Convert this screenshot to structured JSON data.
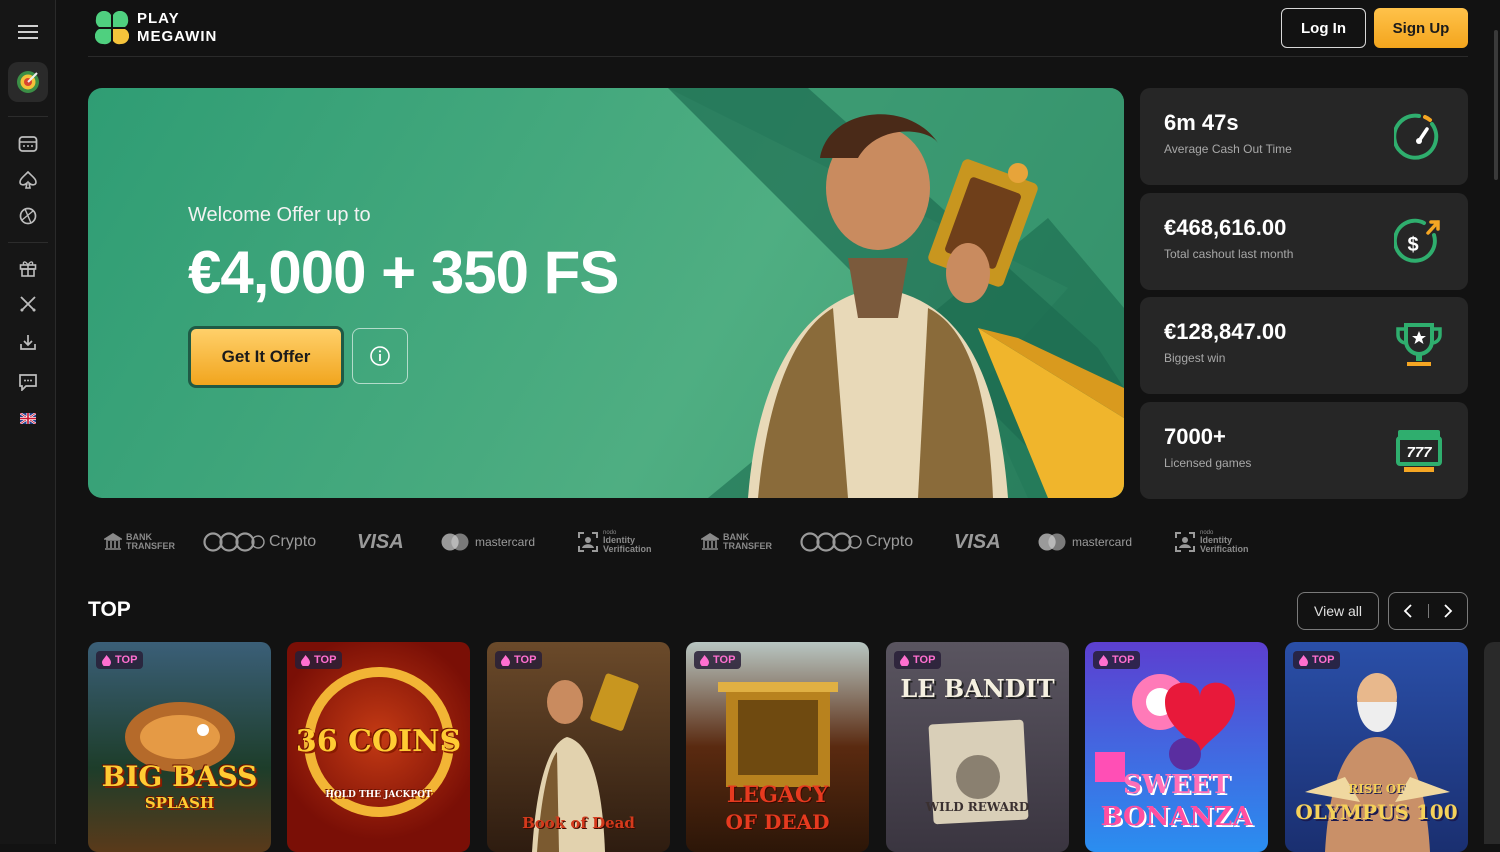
{
  "brand": {
    "line1": "PLAY",
    "line2": "MEGAWIN"
  },
  "header": {
    "login_label": "Log In",
    "signup_label": "Sign Up"
  },
  "sidebar": {
    "icons": [
      "menu-icon",
      "target-icon",
      "slot-machine-icon",
      "spade-icon",
      "sports-icon",
      "gift-icon",
      "tournament-icon",
      "download-icon",
      "chat-icon",
      "uk-flag-icon"
    ]
  },
  "hero": {
    "subtitle": "Welcome Offer up to",
    "title": "€4,000 + 350 FS",
    "cta_label": "Get It Offer"
  },
  "stats": [
    {
      "value": "6m 47s",
      "label": "Average Cash Out Time",
      "icon": "speedometer-icon"
    },
    {
      "value": "€468,616.00",
      "label": "Total cashout last month",
      "icon": "dollar-cashout-icon"
    },
    {
      "value": "€128,847.00",
      "label": "Biggest win",
      "icon": "trophy-icon"
    },
    {
      "value": "7000+",
      "label": "Licensed games",
      "icon": "slot-777-icon"
    }
  ],
  "payments": {
    "bank_line1": "BANK",
    "bank_line2": "TRANSFER",
    "crypto": "Crypto",
    "visa": "VISA",
    "mastercard": "mastercard",
    "identity_line0": "nodo",
    "identity_line1": "Identity",
    "identity_line2": "Verification"
  },
  "top_section": {
    "title": "TOP",
    "view_all_label": "View all",
    "badge_label": "TOP",
    "games": [
      {
        "title": "BIG BASS",
        "subtitle": "SPLASH"
      },
      {
        "title": "36 COINS",
        "subtitle": "HOLD THE JACKPOT"
      },
      {
        "title": "Book of Dead",
        "subtitle": ""
      },
      {
        "title": "LEGACY",
        "subtitle": "OF DEAD"
      },
      {
        "title": "LE BANDIT",
        "subtitle": "WILD REWARD"
      },
      {
        "title": "SWEET",
        "subtitle": "BONANZA"
      },
      {
        "title": "RISE OF",
        "subtitle": "OLYMPUS 100"
      }
    ]
  },
  "colors": {
    "accent": "#f5a623",
    "hero_green": "#3d9b72",
    "card_bg": "#262626",
    "stat_icon": "#2fae6e"
  }
}
